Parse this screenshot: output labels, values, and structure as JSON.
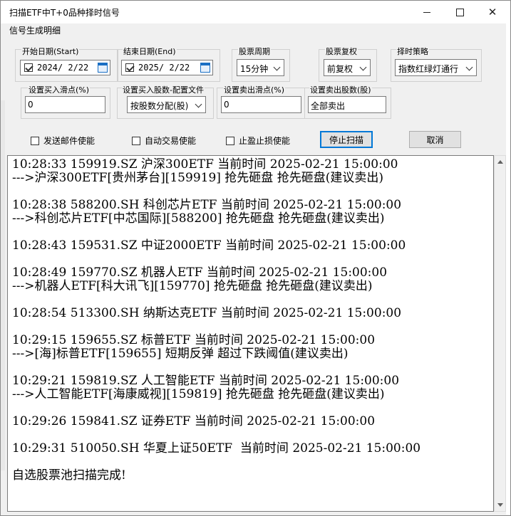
{
  "window": {
    "title": "扫描ETF中T+0品种择时信号"
  },
  "group": {
    "title": "信号生成明细"
  },
  "start_date": {
    "label": "开始日期(Start)",
    "value": "2024/  2/22",
    "checked": true
  },
  "end_date": {
    "label": "结束日期(End)",
    "value": "2025/  2/22",
    "checked": true
  },
  "stock_period": {
    "label": "股票周期",
    "value": "15分钟"
  },
  "stock_adjust": {
    "label": "股票复权",
    "value": "前复权"
  },
  "timing_strategy": {
    "label": "择时策略",
    "value": "指数红绿灯通行"
  },
  "buy_slippage": {
    "label": "设置买入滑点(%)",
    "value": "0"
  },
  "buy_shares": {
    "label": "设置买入股数-配置文件",
    "value": "按股数分配(股)"
  },
  "sell_slippage": {
    "label": "设置卖出滑点(%)",
    "value": "0"
  },
  "sell_shares": {
    "label": "设置卖出股数(股)",
    "value": "全部卖出"
  },
  "options": {
    "email": "发送邮件使能",
    "auto_trade": "自动交易使能",
    "stop_profit_loss": "止盈止损使能"
  },
  "buttons": {
    "stop_scan": "停止扫描",
    "cancel": "取消"
  },
  "log": [
    "10:28:33 159919.SZ 沪深300ETF 当前时间 2025-02-21 15:00:00",
    "--->沪深300ETF[贵州茅台][159919] 抢先砸盘 抢先砸盘(建议卖出)",
    "",
    "10:28:38 588200.SH 科创芯片ETF 当前时间 2025-02-21 15:00:00",
    "--->科创芯片ETF[中芯国际][588200] 抢先砸盘 抢先砸盘(建议卖出)",
    "",
    "10:28:43 159531.SZ 中证2000ETF 当前时间 2025-02-21 15:00:00",
    "",
    "10:28:49 159770.SZ 机器人ETF 当前时间 2025-02-21 15:00:00",
    "--->机器人ETF[科大讯飞][159770] 抢先砸盘 抢先砸盘(建议卖出)",
    "",
    "10:28:54 513300.SH 纳斯达克ETF 当前时间 2025-02-21 15:00:00",
    "",
    "10:29:15 159655.SZ 标普ETF 当前时间 2025-02-21 15:00:00",
    "--->[海]标普ETF[159655] 短期反弹 超过下跌阈值(建议卖出)",
    "",
    "10:29:21 159819.SZ 人工智能ETF 当前时间 2025-02-21 15:00:00",
    "--->人工智能ETF[海康威视][159819] 抢先砸盘 抢先砸盘(建议卖出)",
    "",
    "10:29:26 159841.SZ 证券ETF 当前时间 2025-02-21 15:00:00",
    "",
    "10:29:31 510050.SH 华夏上证50ETF  当前时间 2025-02-21 15:00:00",
    "",
    "自选股票池扫描完成!"
  ]
}
